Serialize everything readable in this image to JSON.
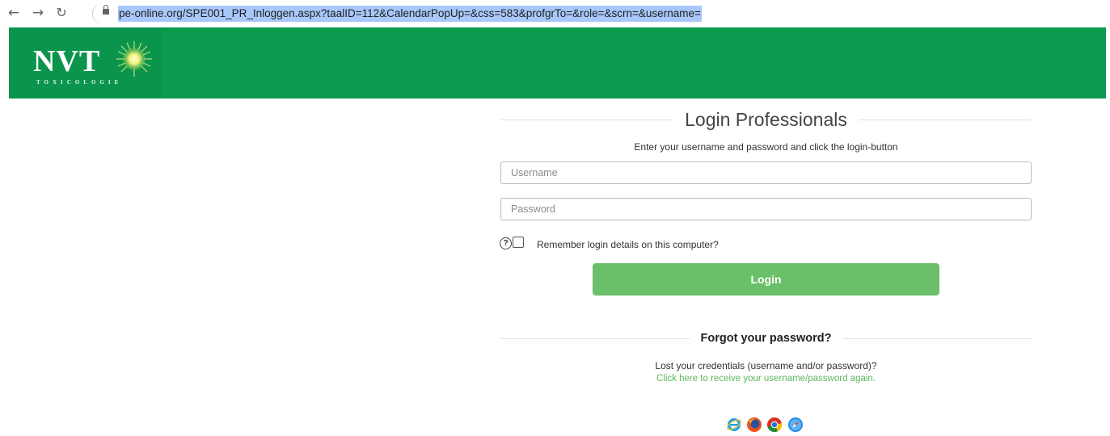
{
  "browser": {
    "url": "pe-online.org/SPE001_PR_Inloggen.aspx?taalID=112&CalendarPopUp=&css=583&profgrTo=&role=&scrn=&username=",
    "back_icon": "arrow-left-icon",
    "forward_icon": "arrow-right-icon",
    "reload_icon": "reload-icon",
    "lock_icon": "lock-icon"
  },
  "header": {
    "logo_text": "NVT",
    "logo_subtext": "TOXICOLOGIE",
    "banner_color": "#0c9a4f"
  },
  "login": {
    "title": "Login Professionals",
    "instructions": "Enter your username and password and click the login-button",
    "username_placeholder": "Username",
    "password_placeholder": "Password",
    "remember_label": "Remember login details on this computer?",
    "login_button": "Login",
    "button_color": "#6abf69"
  },
  "forgot": {
    "title": "Forgot your password?",
    "text": "Lost your credentials (username and/or password)?",
    "link": "Click here to receive your username/password again."
  },
  "supported_browsers": [
    "internet-explorer-icon",
    "firefox-icon",
    "chrome-icon",
    "safari-icon"
  ]
}
